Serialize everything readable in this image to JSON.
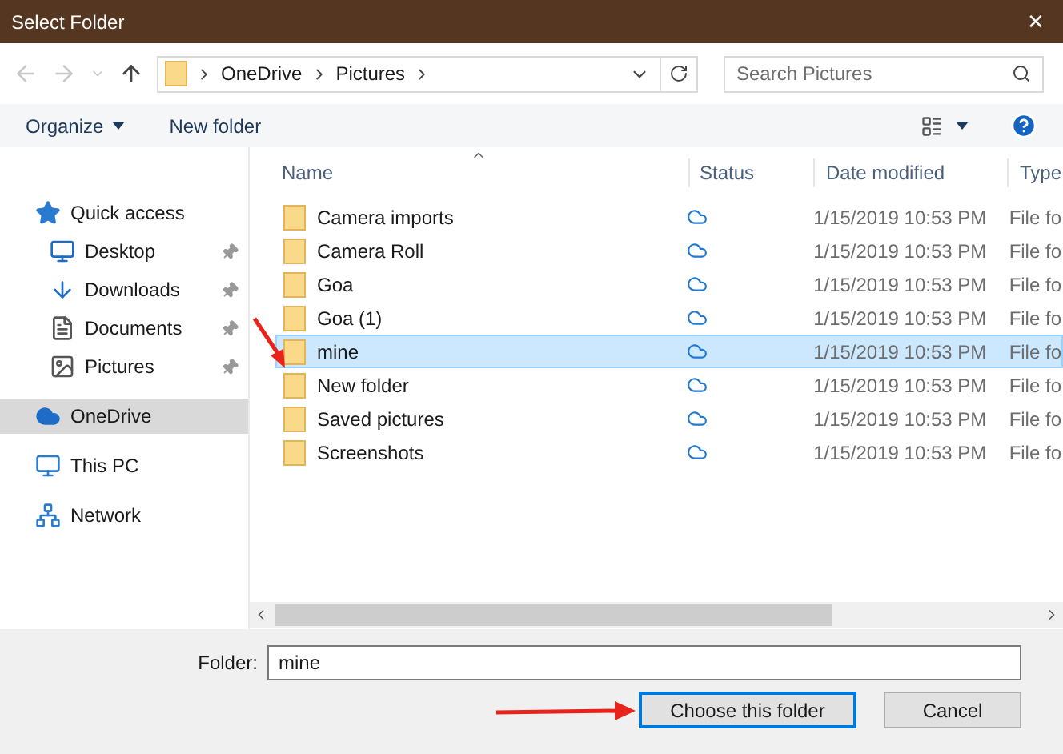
{
  "window": {
    "title": "Select Folder",
    "close": "✕"
  },
  "nav": {
    "path": [
      {
        "label": "OneDrive"
      },
      {
        "label": "Pictures"
      }
    ],
    "search": {
      "placeholder": "Search Pictures"
    }
  },
  "toolbar": {
    "organize": "Organize",
    "new_folder": "New folder"
  },
  "sidebar": {
    "items": [
      {
        "label": "Quick access",
        "pinned": false,
        "selected": false,
        "children": [
          {
            "label": "Desktop",
            "pinned": true,
            "selected": false
          },
          {
            "label": "Downloads",
            "pinned": true,
            "selected": false
          },
          {
            "label": "Documents",
            "pinned": true,
            "selected": false
          },
          {
            "label": "Pictures",
            "pinned": true,
            "selected": false
          }
        ]
      },
      {
        "label": "OneDrive",
        "pinned": false,
        "selected": true
      },
      {
        "label": "This PC",
        "pinned": false,
        "selected": false
      },
      {
        "label": "Network",
        "pinned": false,
        "selected": false
      }
    ]
  },
  "table": {
    "columns": [
      "Name",
      "Status",
      "Date modified",
      "Type"
    ],
    "rows": [
      {
        "name": "Camera imports",
        "date": "1/15/2019 10:53 PM",
        "type": "File fo",
        "selected": false,
        "pointed": false
      },
      {
        "name": "Camera Roll",
        "date": "1/15/2019 10:53 PM",
        "type": "File fo",
        "selected": false,
        "pointed": false
      },
      {
        "name": "Goa",
        "date": "1/15/2019 10:53 PM",
        "type": "File fo",
        "selected": false,
        "pointed": false
      },
      {
        "name": "Goa (1)",
        "date": "1/15/2019 10:53 PM",
        "type": "File fo",
        "selected": false,
        "pointed": false
      },
      {
        "name": "mine",
        "date": "1/15/2019 10:53 PM",
        "type": "File fo",
        "selected": true,
        "pointed": true
      },
      {
        "name": "New folder",
        "date": "1/15/2019 10:53 PM",
        "type": "File fo",
        "selected": false,
        "pointed": false
      },
      {
        "name": "Saved pictures",
        "date": "1/15/2019 10:53 PM",
        "type": "File fo",
        "selected": false,
        "pointed": false
      },
      {
        "name": "Screenshots",
        "date": "1/15/2019 10:53 PM",
        "type": "File fo",
        "selected": false,
        "pointed": false
      }
    ]
  },
  "folder_field": {
    "label": "Folder:",
    "value": "mine"
  },
  "buttons": [
    {
      "label": "Choose this folder",
      "selected": true,
      "pointed": true
    },
    {
      "label": "Cancel",
      "selected": false,
      "pointed": false
    }
  ]
}
